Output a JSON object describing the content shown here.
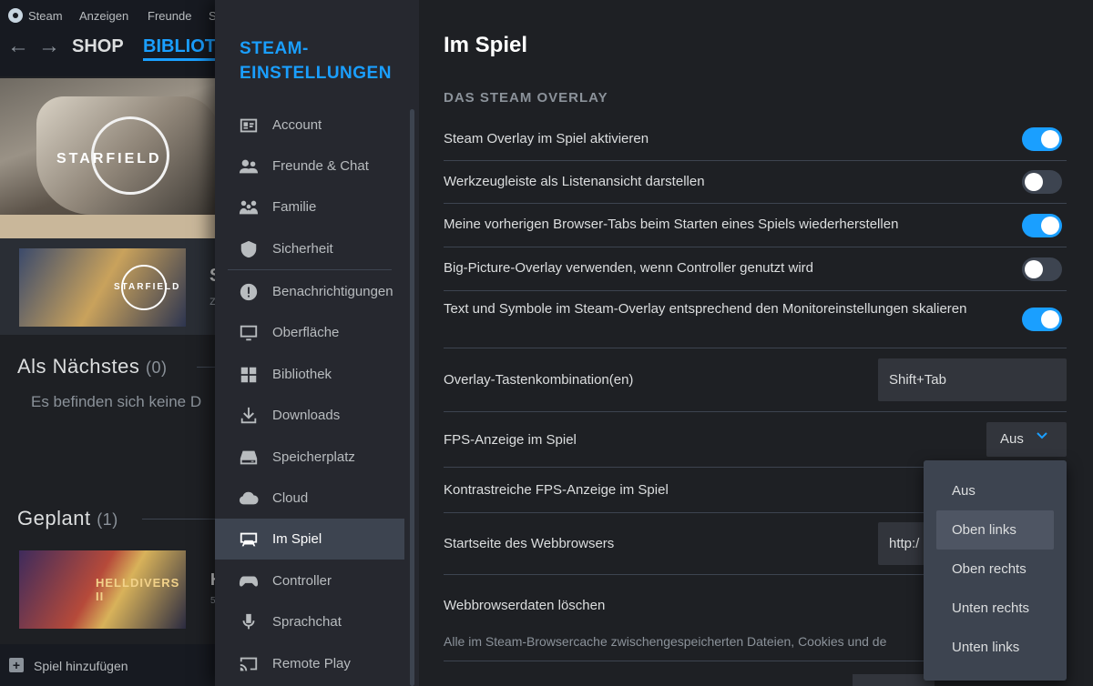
{
  "background": {
    "menu": [
      "Steam",
      "Anzeigen",
      "Freunde",
      "S"
    ],
    "nav": {
      "shop": "SHOP",
      "library": "BIBLIOTHEK"
    },
    "hero_title": "STARFIELD",
    "game_thumb_title": "STARFIELD",
    "game_cut_title": "S",
    "game_cut_sub": "z",
    "section_next": {
      "title": "Als Nächstes",
      "count": "(0)"
    },
    "empty_text": "Es befinden sich keine D",
    "section_planned": {
      "title": "Geplant",
      "count": "(1)"
    },
    "game2_title": "HELLDIVERS II",
    "game2_cut": "H",
    "game2_cut_sub": "5",
    "add_game": "Spiel hinzufügen"
  },
  "settings": {
    "sidebar_title": "STEAM-EINSTELLUNGEN",
    "sidebar_items": [
      {
        "label": "Account",
        "icon": "account-card-icon"
      },
      {
        "label": "Freunde & Chat",
        "icon": "friends-icon"
      },
      {
        "label": "Familie",
        "icon": "family-icon"
      },
      {
        "label": "Sicherheit",
        "icon": "shield-icon"
      },
      {
        "label": "Benachrichtigungen",
        "icon": "alert-icon"
      },
      {
        "label": "Oberfläche",
        "icon": "monitor-icon"
      },
      {
        "label": "Bibliothek",
        "icon": "grid-icon"
      },
      {
        "label": "Downloads",
        "icon": "download-icon"
      },
      {
        "label": "Speicherplatz",
        "icon": "drive-icon"
      },
      {
        "label": "Cloud",
        "icon": "cloud-icon"
      },
      {
        "label": "Im Spiel",
        "icon": "in-game-icon"
      },
      {
        "label": "Controller",
        "icon": "gamepad-icon"
      },
      {
        "label": "Sprachchat",
        "icon": "microphone-icon"
      },
      {
        "label": "Remote Play",
        "icon": "cast-icon"
      }
    ],
    "active_item": "Im Spiel",
    "page_title": "Im Spiel",
    "section_title": "DAS STEAM OVERLAY",
    "toggles": [
      {
        "label": "Steam Overlay im Spiel aktivieren",
        "on": true
      },
      {
        "label": "Werkzeugleiste als Listenansicht darstellen",
        "on": false
      },
      {
        "label": "Meine vorherigen Browser-Tabs beim Starten eines Spiels wiederherstellen",
        "on": true
      },
      {
        "label": "Big-Picture-Overlay verwenden, wenn Controller genutzt wird",
        "on": false
      },
      {
        "label": "Text und Symbole im Steam-Overlay entsprechend den Monitoreinstellungen skalieren",
        "on": true
      }
    ],
    "hotkey": {
      "label": "Overlay-Tastenkombination(en)",
      "value": "Shift+Tab"
    },
    "fps": {
      "label": "FPS-Anzeige im Spiel",
      "value": "Aus"
    },
    "fps_contrast": {
      "label": "Kontrastreiche FPS-Anzeige im Spiel"
    },
    "homepage": {
      "label": "Startseite des Webbrowsers",
      "value": "http:/"
    },
    "browser_data": {
      "label": "Webbrowserdaten löschen",
      "description": "Alle im Steam-Browsercache zwischengespeicherten Dateien, Cookies und de"
    },
    "fps_options": [
      "Aus",
      "Oben links",
      "Oben rechts",
      "Unten rechts",
      "Unten links"
    ],
    "fps_hover": "Oben links"
  },
  "colors": {
    "accent": "#1a9fff",
    "sidebar": "#26282f",
    "main": "#1e2024",
    "popup": "#3d4450"
  }
}
